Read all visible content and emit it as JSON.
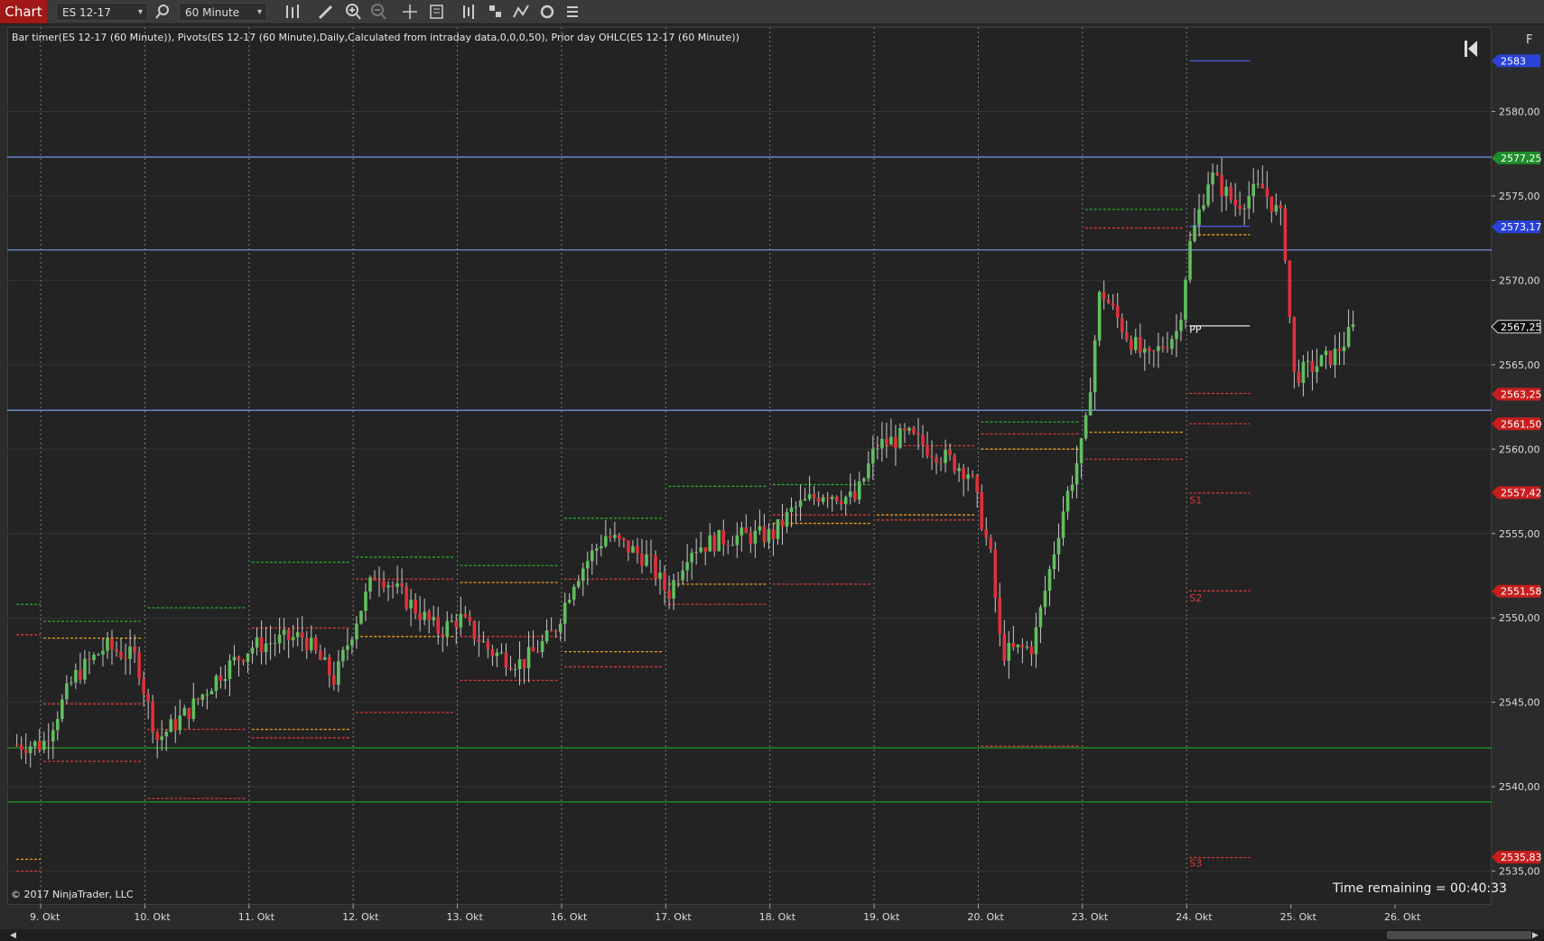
{
  "toolbar": {
    "chart_tab": "Chart",
    "instrument": "ES 12-17",
    "interval": "60 Minute",
    "icons": [
      "search-icon",
      "bar-type-icon",
      "draw-pencil-icon",
      "zoom-in-icon",
      "zoom-out-icon",
      "crosshair-icon",
      "properties-icon",
      "indicators-icon",
      "strategies-icon",
      "chart-trader-icon",
      "refresh-icon",
      "data-box-icon"
    ]
  },
  "indicator_text": "Bar timer(ES 12-17 (60 Minute)), Pivots(ES 12-17 (60 Minute),Daily,Calculated from intraday data,0,0,0,50), Prior day OHLC(ES 12-17 (60 Minute))",
  "copyright": "© 2017 NinjaTrader, LLC",
  "time_remaining": "Time remaining = 00:40:33",
  "f_label": "F",
  "chart_data": {
    "type": "candlestick",
    "instrument": "ES 12-17",
    "interval": "60 Minute",
    "ylim": [
      2533,
      2585
    ],
    "y_ticks": [
      "2580,00",
      "2575,00",
      "2570,00",
      "2565,00",
      "2560,00",
      "2555,00",
      "2550,00",
      "2545,00",
      "2540,00",
      "2535,00"
    ],
    "y_tick_values": [
      2580,
      2575,
      2570,
      2565,
      2560,
      2555,
      2550,
      2545,
      2540,
      2535
    ],
    "x_labels": [
      "9. Okt",
      "10. Okt",
      "11. Okt",
      "12. Okt",
      "13. Okt",
      "16. Okt",
      "17. Okt",
      "18. Okt",
      "19. Okt",
      "20. Okt",
      "23. Okt",
      "24. Okt",
      "25. Okt",
      "26. Okt"
    ],
    "day_slots": 14,
    "bars_per_day": 23,
    "colors": {
      "up": "#5fbf5f",
      "down": "#e0313b",
      "background": "#232323",
      "grid": "#343434",
      "day_sep": "#7d7d7d",
      "h_blue": "#6f8fd6",
      "h_green": "#1f9a2a",
      "pivot_green": "#2aa82a",
      "pivot_red": "#d43a3a",
      "pivot_orange": "#e8a020",
      "pivot_blue": "#4a5ae0"
    },
    "horizontal_lines": [
      {
        "value": 2577.3,
        "color": "blue"
      },
      {
        "value": 2571.8,
        "color": "blue"
      },
      {
        "value": 2562.3,
        "color": "blue"
      },
      {
        "value": 2542.3,
        "color": "green"
      },
      {
        "value": 2539.1,
        "color": "green"
      }
    ],
    "price_badges": [
      {
        "label": "2583",
        "value": 2583.0,
        "bg": "#2b42d8",
        "fg": "#ffffff"
      },
      {
        "label": "2577,25",
        "value": 2577.25,
        "bg": "#1d8d2a",
        "fg": "#ffffff"
      },
      {
        "label": "2573,17",
        "value": 2573.17,
        "bg": "#2b42d8",
        "fg": "#ffffff"
      },
      {
        "label": "2567,25",
        "value": 2567.25,
        "bg": "#111111",
        "fg": "#ffffff",
        "border": "#dddddd"
      },
      {
        "label": "2563,25",
        "value": 2563.25,
        "bg": "#c81e1e",
        "fg": "#ffffff"
      },
      {
        "label": "2561,50",
        "value": 2561.5,
        "bg": "#c81e1e",
        "fg": "#ffffff"
      },
      {
        "label": "2557,42",
        "value": 2557.42,
        "bg": "#c81e1e",
        "fg": "#ffffff"
      },
      {
        "label": "2551,58",
        "value": 2551.58,
        "bg": "#c81e1e",
        "fg": "#ffffff"
      },
      {
        "label": "2535,83",
        "value": 2535.83,
        "bg": "#c81e1e",
        "fg": "#ffffff"
      }
    ],
    "pivot_labels": [
      {
        "text": "PP",
        "value": 2567.1,
        "color": "#ffffff"
      },
      {
        "text": "S1",
        "value": 2557.0,
        "color": "#d43a3a"
      },
      {
        "text": "S2",
        "value": 2551.2,
        "color": "#d43a3a"
      },
      {
        "text": "S3",
        "value": 2535.5,
        "color": "#d43a3a"
      }
    ],
    "pivot_levels": [
      {
        "day": 0,
        "value": 2550.8,
        "color": "green"
      },
      {
        "day": 0,
        "value": 2549.0,
        "color": "red"
      },
      {
        "day": 0,
        "value": 2535.7,
        "color": "orange"
      },
      {
        "day": 0,
        "value": 2535.0,
        "color": "red"
      },
      {
        "day": 1,
        "value": 2549.8,
        "color": "green"
      },
      {
        "day": 1,
        "value": 2548.8,
        "color": "orange"
      },
      {
        "day": 1,
        "value": 2544.9,
        "color": "red"
      },
      {
        "day": 1,
        "value": 2541.5,
        "color": "red"
      },
      {
        "day": 2,
        "value": 2550.6,
        "color": "green"
      },
      {
        "day": 2,
        "value": 2543.4,
        "color": "red"
      },
      {
        "day": 2,
        "value": 2539.3,
        "color": "red"
      },
      {
        "day": 3,
        "value": 2553.3,
        "color": "green"
      },
      {
        "day": 3,
        "value": 2549.4,
        "color": "red"
      },
      {
        "day": 3,
        "value": 2543.4,
        "color": "orange"
      },
      {
        "day": 3,
        "value": 2542.9,
        "color": "red"
      },
      {
        "day": 4,
        "value": 2553.6,
        "color": "green"
      },
      {
        "day": 4,
        "value": 2552.3,
        "color": "red"
      },
      {
        "day": 4,
        "value": 2548.9,
        "color": "orange"
      },
      {
        "day": 4,
        "value": 2544.4,
        "color": "red"
      },
      {
        "day": 5,
        "value": 2553.1,
        "color": "green"
      },
      {
        "day": 5,
        "value": 2552.1,
        "color": "orange"
      },
      {
        "day": 5,
        "value": 2548.9,
        "color": "red"
      },
      {
        "day": 5,
        "value": 2546.3,
        "color": "red"
      },
      {
        "day": 6,
        "value": 2555.9,
        "color": "green"
      },
      {
        "day": 6,
        "value": 2552.3,
        "color": "red"
      },
      {
        "day": 6,
        "value": 2548.0,
        "color": "orange"
      },
      {
        "day": 6,
        "value": 2547.1,
        "color": "red"
      },
      {
        "day": 7,
        "value": 2557.8,
        "color": "green"
      },
      {
        "day": 7,
        "value": 2552.0,
        "color": "orange"
      },
      {
        "day": 7,
        "value": 2550.8,
        "color": "red"
      },
      {
        "day": 8,
        "value": 2557.9,
        "color": "green"
      },
      {
        "day": 8,
        "value": 2556.1,
        "color": "red"
      },
      {
        "day": 8,
        "value": 2555.6,
        "color": "orange"
      },
      {
        "day": 8,
        "value": 2552.0,
        "color": "red"
      },
      {
        "day": 9,
        "value": 2560.2,
        "color": "red"
      },
      {
        "day": 9,
        "value": 2556.1,
        "color": "orange"
      },
      {
        "day": 9,
        "value": 2555.8,
        "color": "red"
      },
      {
        "day": 10,
        "value": 2561.6,
        "color": "green"
      },
      {
        "day": 10,
        "value": 2560.9,
        "color": "red"
      },
      {
        "day": 10,
        "value": 2560.0,
        "color": "orange"
      },
      {
        "day": 10,
        "value": 2542.4,
        "color": "red"
      },
      {
        "day": 11,
        "value": 2574.2,
        "color": "green"
      },
      {
        "day": 11,
        "value": 2573.1,
        "color": "red"
      },
      {
        "day": 11,
        "value": 2561.0,
        "color": "orange"
      },
      {
        "day": 11,
        "value": 2559.4,
        "color": "red"
      },
      {
        "day": 12,
        "value": 2583.0,
        "color": "blue"
      },
      {
        "day": 12,
        "value": 2573.2,
        "color": "blue"
      },
      {
        "day": 12,
        "value": 2572.7,
        "color": "orange"
      },
      {
        "day": 12,
        "value": 2567.3,
        "color": "white"
      },
      {
        "day": 12,
        "value": 2563.3,
        "color": "red"
      },
      {
        "day": 12,
        "value": 2561.5,
        "color": "red"
      },
      {
        "day": 12,
        "value": 2557.4,
        "color": "red"
      },
      {
        "day": 12,
        "value": 2551.6,
        "color": "red"
      },
      {
        "day": 12,
        "value": 2535.8,
        "color": "red"
      }
    ],
    "close_path": [
      [
        0,
        2542.5
      ],
      [
        0.3,
        2546.5
      ],
      [
        0.6,
        2548.3
      ],
      [
        0.9,
        2547.6
      ],
      [
        1.0,
        2545.0
      ],
      [
        1.1,
        2542.8
      ],
      [
        1.4,
        2544.5
      ],
      [
        1.7,
        2546.7
      ],
      [
        2.0,
        2548.3
      ],
      [
        2.3,
        2548.7
      ],
      [
        2.5,
        2548.9
      ],
      [
        2.8,
        2546.3
      ],
      [
        3.0,
        2549.8
      ],
      [
        3.2,
        2552.8
      ],
      [
        3.5,
        2551.0
      ],
      [
        3.8,
        2549.2
      ],
      [
        4.0,
        2550.0
      ],
      [
        4.3,
        2548.0
      ],
      [
        4.6,
        2547.3
      ],
      [
        4.9,
        2549.1
      ],
      [
        5.1,
        2552.3
      ],
      [
        5.4,
        2554.9
      ],
      [
        5.8,
        2553.5
      ],
      [
        6.0,
        2551.4
      ],
      [
        6.2,
        2554.1
      ],
      [
        6.6,
        2554.8
      ],
      [
        7.0,
        2554.9
      ],
      [
        7.2,
        2556.4
      ],
      [
        7.5,
        2557.5
      ],
      [
        7.8,
        2557.0
      ],
      [
        8.0,
        2560.2
      ],
      [
        8.3,
        2560.8
      ],
      [
        8.6,
        2559.7
      ],
      [
        8.9,
        2558.6
      ],
      [
        9.1,
        2553.5
      ],
      [
        9.2,
        2547.9
      ],
      [
        9.5,
        2548.3
      ],
      [
        9.8,
        2556.6
      ],
      [
        10.0,
        2560.8
      ],
      [
        10.15,
        2569.5
      ],
      [
        10.4,
        2566.8
      ],
      [
        10.6,
        2565.2
      ],
      [
        10.9,
        2567.1
      ],
      [
        11.0,
        2571.9
      ],
      [
        11.2,
        2576.3
      ],
      [
        11.45,
        2574.5
      ],
      [
        11.7,
        2575.5
      ],
      [
        11.9,
        2573.5
      ],
      [
        11.95,
        2569.7
      ],
      [
        12.0,
        2564.3
      ],
      [
        12.2,
        2564.9
      ],
      [
        12.4,
        2565.6
      ],
      [
        12.6,
        2567.3
      ]
    ]
  }
}
